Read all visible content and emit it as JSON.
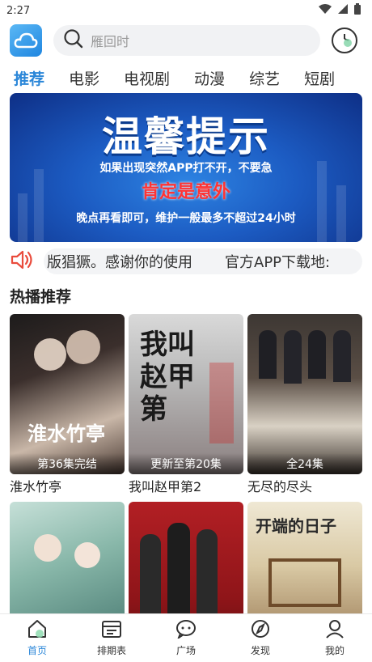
{
  "status_bar": {
    "time": "2:27"
  },
  "search": {
    "placeholder": "雁回时"
  },
  "tabs": [
    "推荐",
    "电影",
    "电视剧",
    "动漫",
    "综艺",
    "短剧"
  ],
  "banner": {
    "title": "温馨提示",
    "line1": "如果出现突然APP打不开，不要急",
    "line2": "肯定是意外",
    "line3": "晚点再看即可，维护一般最多不超过24小时"
  },
  "notice": {
    "text1": "版猖獗。感谢你的使用",
    "text2": "官方APP下载地:"
  },
  "hot_section": {
    "title": "热播推荐"
  },
  "shows": [
    {
      "title": "淮水竹亭",
      "badge": "第36集完结",
      "poster_text": "淮水竹亭"
    },
    {
      "title": "我叫赵甲第2",
      "badge": "更新至第20集",
      "poster_text": "我叫赵甲第"
    },
    {
      "title": "无尽的尽头",
      "badge": "全24集",
      "poster_text": ""
    },
    {
      "title": "",
      "badge": "",
      "poster_text": ""
    },
    {
      "title": "",
      "badge": "",
      "poster_text": ""
    },
    {
      "title": "",
      "badge": "",
      "poster_text": "开端的日子"
    }
  ],
  "bottom_nav": [
    "首页",
    "排期表",
    "广场",
    "发现",
    "我的"
  ],
  "colors": {
    "accent": "#2a86d8",
    "notice_icon": "#e94b3c"
  }
}
